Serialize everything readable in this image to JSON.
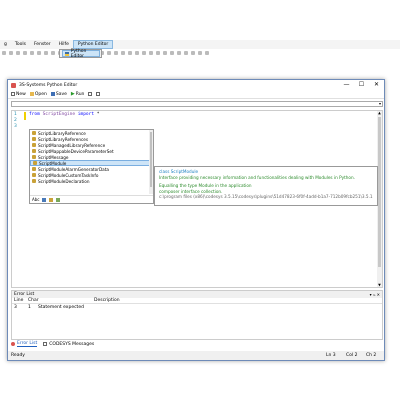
{
  "menubar": {
    "items": [
      {
        "label": "g"
      },
      {
        "label": "Tools"
      },
      {
        "label": "Fenster"
      },
      {
        "label": "Hilfe"
      },
      {
        "label": "Python Editor",
        "active": true
      }
    ]
  },
  "dropdown": {
    "item_label": "Python Editor"
  },
  "window": {
    "title": "3S-Systems Python Editor",
    "controls": {
      "minimize": "—",
      "maximize": "☐",
      "close": "✕"
    }
  },
  "toolbar": {
    "new_label": "New",
    "open_label": "Open",
    "save_label": "Save",
    "run_label": "Run",
    "run_icon": "▶"
  },
  "editor": {
    "lines": [
      {
        "number": "1",
        "keyword": "from",
        "module": "ScriptEngine",
        "keyword2": "import",
        "rest": "*"
      },
      {
        "number": "2",
        "text": ""
      },
      {
        "number": "3",
        "text": ""
      }
    ]
  },
  "autocomplete": {
    "items": [
      "ScriptLibraryReference",
      "ScriptLibraryReferences",
      "ScriptManagedLibraryReference",
      "ScriptMappableDeviceParameterSet",
      "ScriptMessage",
      "ScriptModule",
      "ScriptModuleAlarmGeneratorData",
      "ScriptModuleCustomTaskInfo",
      "ScriptModuleDeclaration"
    ],
    "selected_index": 5,
    "footer": {
      "all_label": "Abc"
    }
  },
  "tooltip": {
    "line1": "class ScriptModule",
    "line2": "Interface providing necessary information and functionalities dealing with Modules in Python.",
    "line3": "Equalling the type Module in the application",
    "line4": "composer interface collection.",
    "line5": "c:\\program files (x86)\\codesys 3.5.15\\codesys\\plugins\\51d47823-6f0f-4add-b1a7-712b09fcb251\\3.5.15.0\\scriptengine.py"
  },
  "error_list": {
    "title": "Error List",
    "controls": "▾ ₘ ✕",
    "columns": [
      "Line",
      "Char",
      "Description"
    ],
    "rows": [
      {
        "line": "3",
        "char": "1",
        "description": "Statement expected"
      }
    ]
  },
  "tabs": [
    {
      "label": "Error List",
      "active": true
    },
    {
      "label": "CODESYS Messages",
      "active": false
    }
  ],
  "statusbar": {
    "status": "Ready",
    "ln": "Ln 3",
    "col": "Col 2",
    "ch": "Ch 2"
  }
}
